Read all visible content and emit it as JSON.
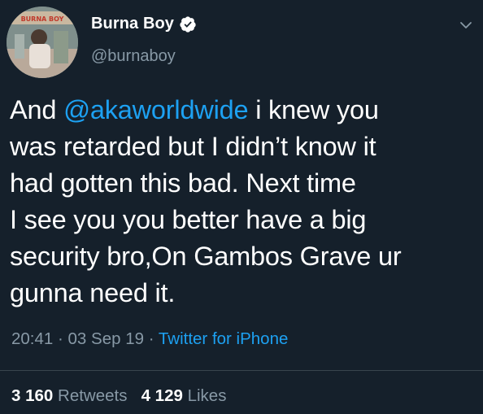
{
  "author": {
    "display_name": "Burna Boy",
    "handle": "@burnaboy",
    "verified": true,
    "avatar_sign_text": "BURNA BOY"
  },
  "tweet": {
    "lines": [
      {
        "prefix": "And ",
        "mention": "@akaworldwide",
        "suffix": " i knew you"
      },
      {
        "text": "was retarded but I didn’t know it"
      },
      {
        "text": "had gotten this bad. Next time"
      },
      {
        "text": "I see you you better have a big"
      },
      {
        "text": "security bro,On Gambos Grave ur"
      },
      {
        "text": "gunna need it."
      }
    ]
  },
  "meta": {
    "time": "20:41",
    "separator": " · ",
    "date": "03 Sep 19",
    "source": "Twitter for iPhone"
  },
  "stats": {
    "retweets_count": "3 160",
    "retweets_label": "Retweets",
    "likes_count": "4 129",
    "likes_label": "Likes"
  },
  "colors": {
    "background": "#15202b",
    "accent": "#1da1f2",
    "secondary_text": "#8899a6",
    "divider": "#38444d"
  },
  "icons": {
    "verified": "verified-badge-icon",
    "menu": "chevron-down-icon"
  }
}
